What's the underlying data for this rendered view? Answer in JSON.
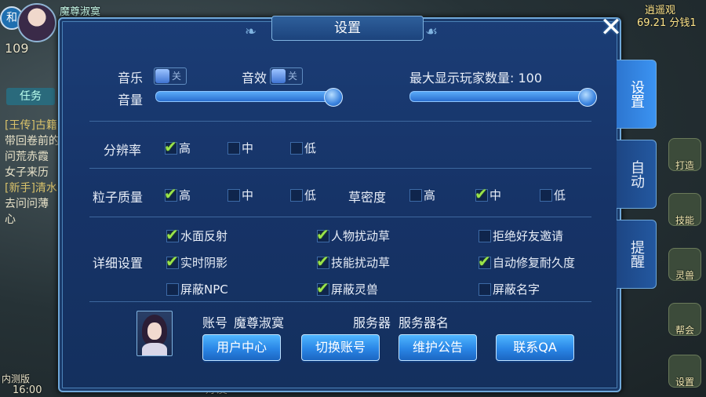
{
  "background_hud": {
    "badge": "和",
    "player_name": "魔尊淑寞",
    "level": "109",
    "task_tab": "任务",
    "quest_lines": [
      "[王传]古籍",
      "带回卷前的",
      "问荒赤霞",
      "女子来历",
      "[新手]清水",
      "去问问薄",
      "心"
    ],
    "time": "16:00",
    "version": "内测版",
    "top_right_title": "逍遥观",
    "top_right_value": "69.21 分钱1",
    "right_icons": [
      "打造",
      "技能",
      "灵兽",
      "帮会",
      "设置"
    ],
    "bottom_center": "好友"
  },
  "dialog": {
    "title": "设置",
    "close_icon": "close-icon",
    "tabs": [
      {
        "label": "设置",
        "active": true
      },
      {
        "label": "自动",
        "active": false
      },
      {
        "label": "提醒",
        "active": false
      }
    ],
    "audio": {
      "music_label": "音乐",
      "music_toggle": "关",
      "sfx_label": "音效",
      "sfx_toggle": "关",
      "volume_label": "音量",
      "volume_level": 1.0
    },
    "max_players": {
      "label": "最大显示玩家数量: 100",
      "level": 1.0
    },
    "resolution": {
      "label": "分辨率",
      "options": [
        {
          "label": "高",
          "checked": true
        },
        {
          "label": "中",
          "checked": false
        },
        {
          "label": "低",
          "checked": false
        }
      ]
    },
    "particle": {
      "label": "粒子质量",
      "options": [
        {
          "label": "高",
          "checked": true
        },
        {
          "label": "中",
          "checked": false
        },
        {
          "label": "低",
          "checked": false
        }
      ]
    },
    "grass": {
      "label": "草密度",
      "options": [
        {
          "label": "高",
          "checked": false
        },
        {
          "label": "中",
          "checked": true
        },
        {
          "label": "低",
          "checked": false
        }
      ]
    },
    "detail": {
      "label": "详细设置",
      "options": [
        {
          "label": "水面反射",
          "checked": true
        },
        {
          "label": "人物扰动草",
          "checked": true
        },
        {
          "label": "拒绝好友邀请",
          "checked": false
        },
        {
          "label": "实时阴影",
          "checked": true
        },
        {
          "label": "技能扰动草",
          "checked": true
        },
        {
          "label": "自动修复耐久度",
          "checked": true
        },
        {
          "label": "屏蔽NPC",
          "checked": false
        },
        {
          "label": "屏蔽灵兽",
          "checked": true
        },
        {
          "label": "屏蔽名字",
          "checked": false
        }
      ]
    },
    "account": {
      "account_label": "账号",
      "account_name": "魔尊淑寞",
      "server_label": "服务器",
      "server_name": "服务器名"
    },
    "buttons": [
      "用户中心",
      "切换账号",
      "维护公告",
      "联系QA"
    ]
  }
}
